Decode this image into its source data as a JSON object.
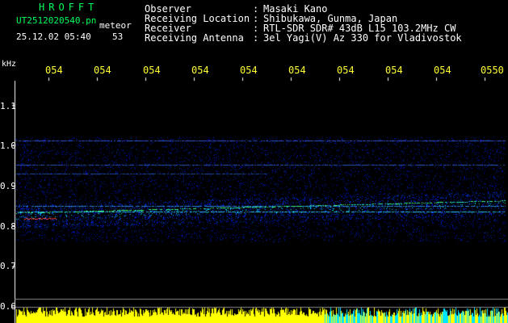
{
  "header": {
    "title": "HROFFT",
    "filename": "UT2512020540.pn",
    "tag": "meteor",
    "datetime": "25.12.02 05:40",
    "count": "53"
  },
  "info": [
    {
      "label": "Observer",
      "value": "Masaki Kano"
    },
    {
      "label": "Receiving Location",
      "value": "Shibukawa, Gunma, Japan"
    },
    {
      "label": "Receiver",
      "value": "RTL-SDR SDR# 43dB L15 103.2MHz CW"
    },
    {
      "label": "Receiving Antenna",
      "value": "3el Yagi(V) Az 330 for Vladivostok"
    }
  ],
  "axis": {
    "unit": "kHz",
    "y_labels": [
      "1.1",
      "1.0",
      "0.9",
      "0.8",
      "0.7",
      "0.6"
    ],
    "x_labels": [
      "054",
      "054",
      "054",
      "054",
      "054",
      "054",
      "054",
      "054",
      "054",
      "0550"
    ]
  },
  "colors": {
    "accent_green": "#00ff5a",
    "text_white": "#ffffff",
    "tick_yellow": "#ffff33",
    "bar_yellow": "#ffff00",
    "bar_cyan": "#00e5ff"
  }
}
